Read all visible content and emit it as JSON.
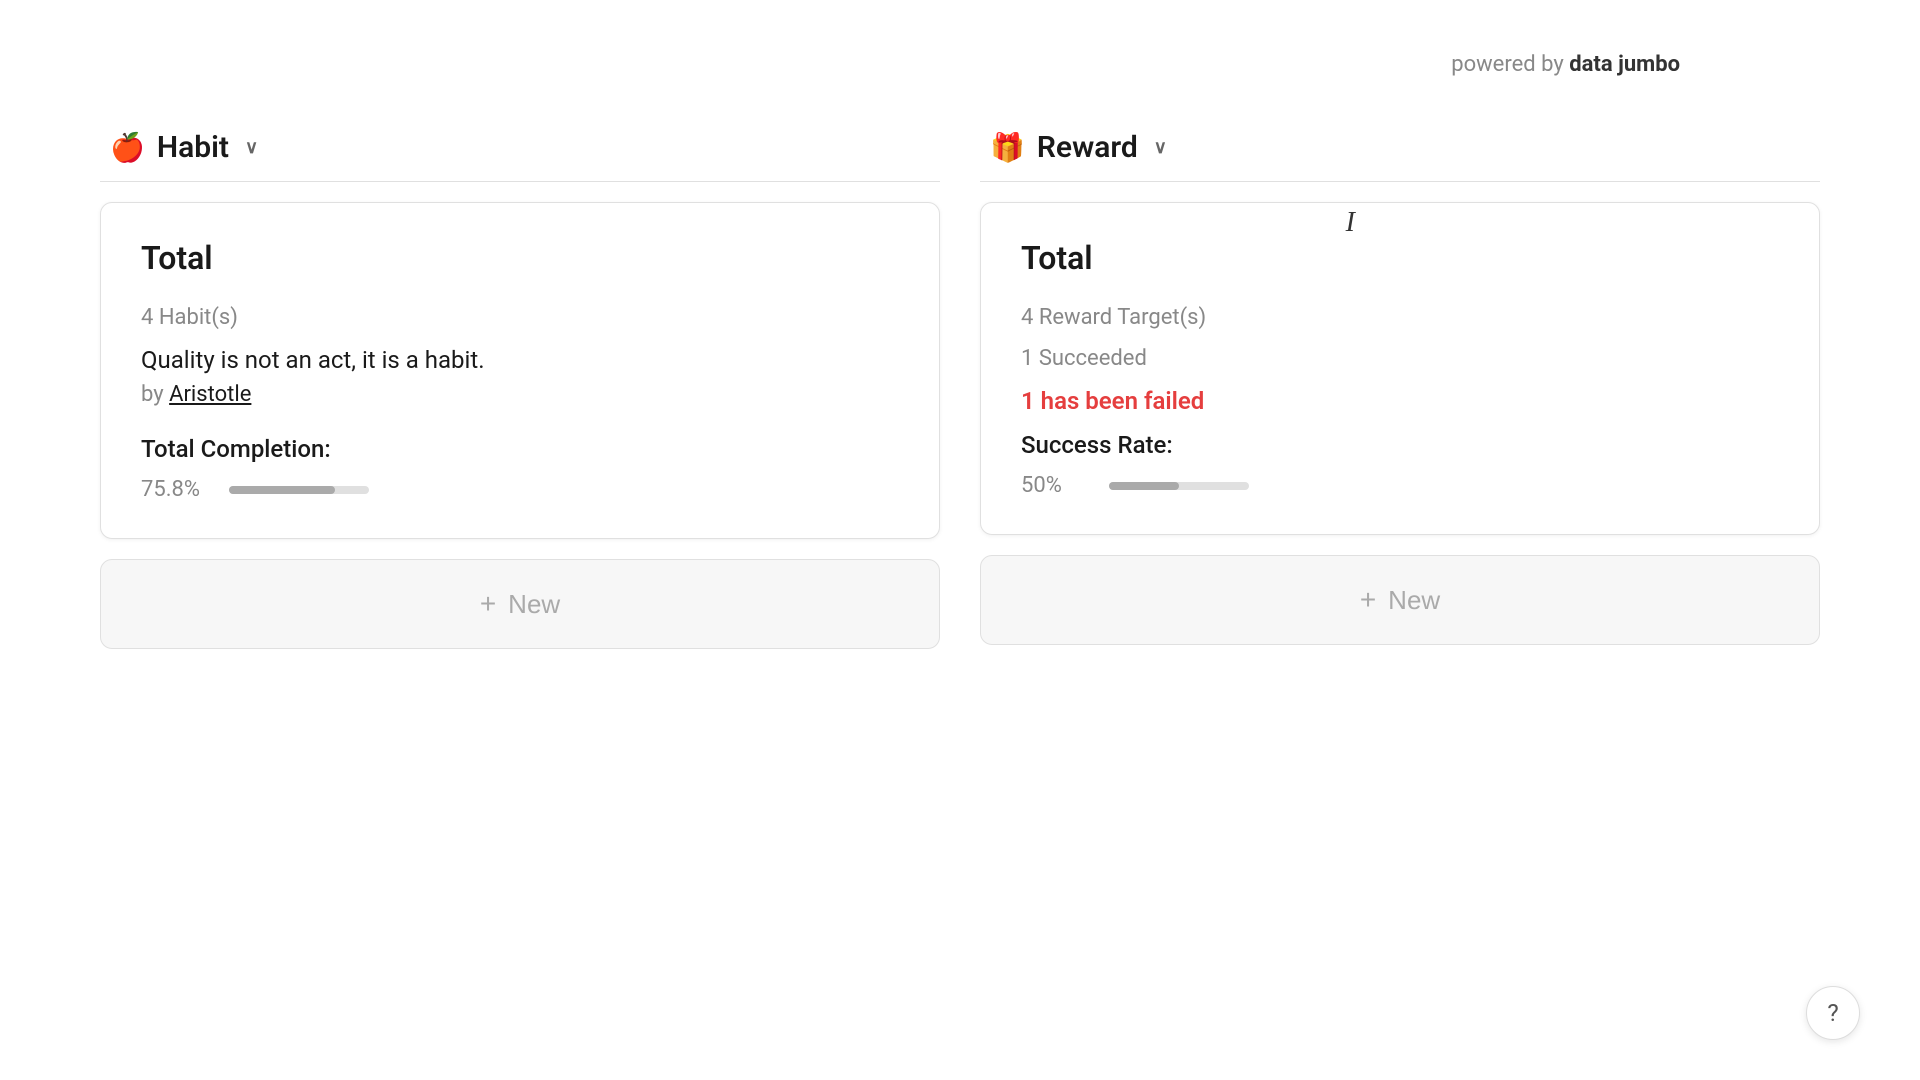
{
  "branding": {
    "powered_by": "powered by",
    "brand_name": "data jumbo"
  },
  "habit_column": {
    "icon": "🍎",
    "title": "Habit",
    "chevron": "∨",
    "card": {
      "title": "Total",
      "habits_count": "4 Habit(s)",
      "quote": "Quality is not an act, it is a habit.",
      "author_prefix": "by",
      "author_name": "Aristotle",
      "completion_label": "Total Completion:",
      "completion_value": "75.8%",
      "completion_percent": 75.8
    },
    "new_button": "+ New"
  },
  "reward_column": {
    "icon": "🎁",
    "title": "Reward",
    "chevron": "∨",
    "card": {
      "title": "Total",
      "targets_count": "4 Reward Target(s)",
      "succeeded": "1 Succeeded",
      "failed": "1 has been failed",
      "success_rate_label": "Success Rate:",
      "success_rate_value": "50%",
      "success_rate_percent": 50
    },
    "new_button": "+ New"
  },
  "cursor": "I",
  "help_button": "?"
}
